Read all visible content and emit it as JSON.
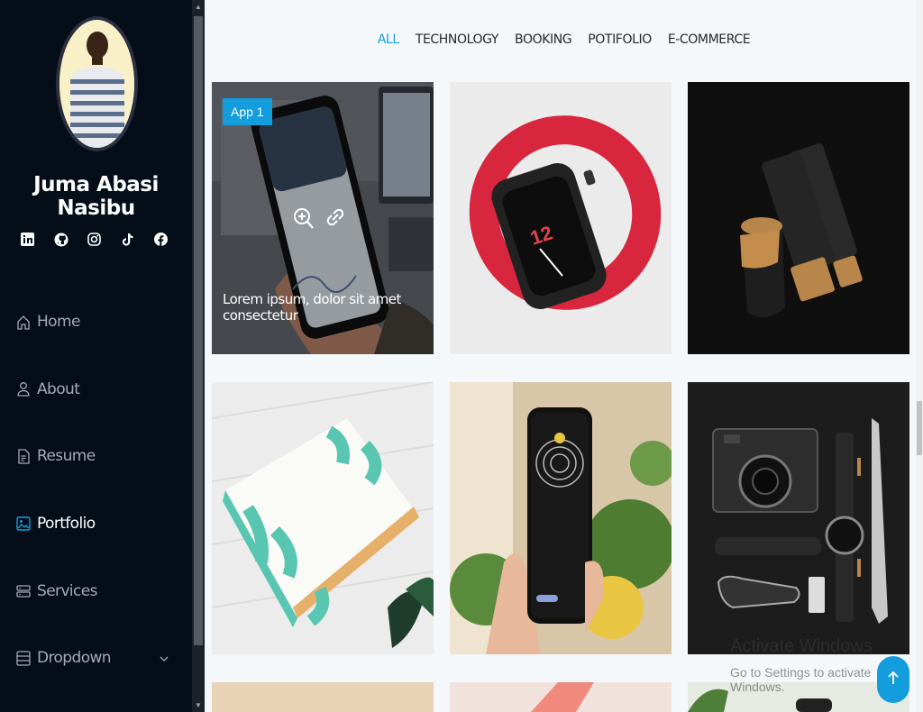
{
  "profile": {
    "name": "Juma Abasi Nasibu"
  },
  "social": [
    "linkedin-icon",
    "github-icon",
    "instagram-icon",
    "tiktok-icon",
    "facebook-icon"
  ],
  "nav": {
    "home": "Home",
    "about": "About",
    "resume": "Resume",
    "portfolio": "Portfolio",
    "services": "Services",
    "dropdown": "Dropdown"
  },
  "filters": {
    "all": "ALL",
    "technology": "TECHNOLOGY",
    "booking": "BOOKING",
    "portfolio": "POTIFOLIO",
    "ecommerce": "E-COMMERCE"
  },
  "portfolio": {
    "badge": "App 1",
    "caption": "Lorem ipsum, dolor sit amet consectetur"
  },
  "watermark": {
    "title": "Activate Windows",
    "subtitle": "Go to Settings to activate Windows."
  },
  "colors": {
    "accent": "#149ddd",
    "sidebar": "#050d18",
    "background": "#f4f8fb"
  }
}
